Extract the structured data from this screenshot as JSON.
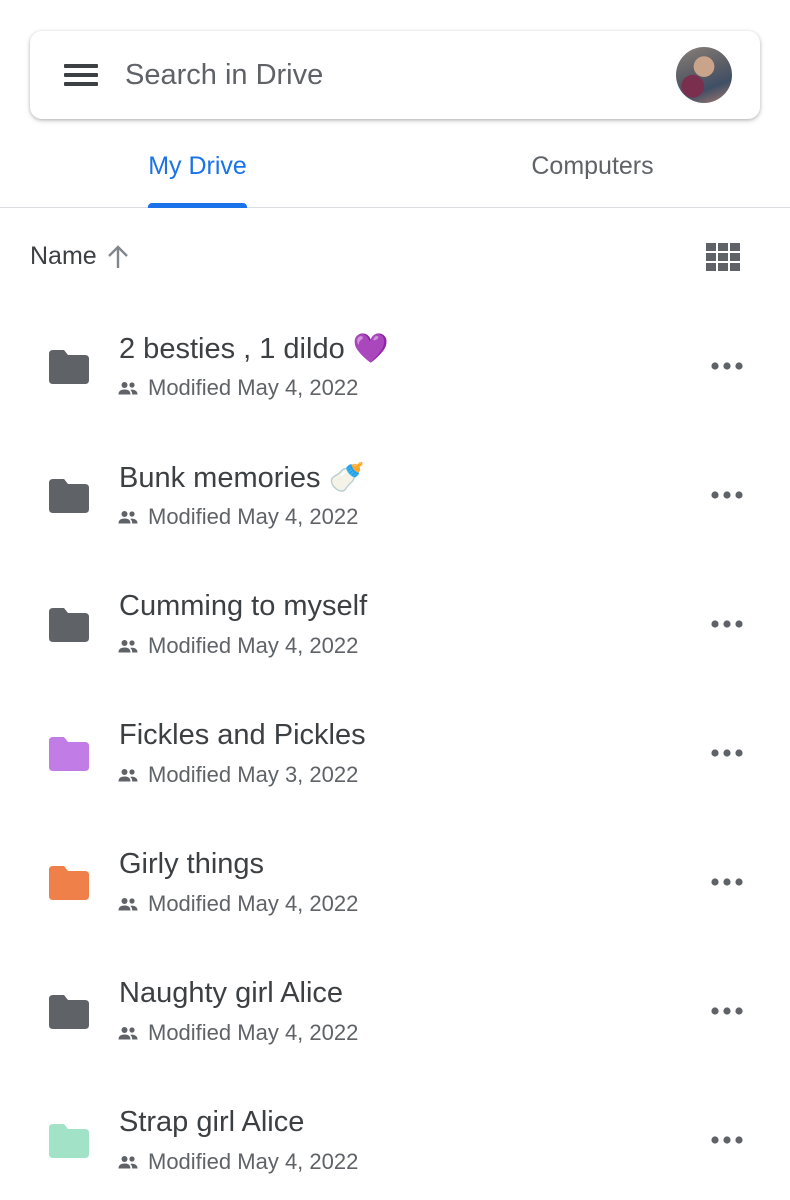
{
  "search": {
    "placeholder": "Search in Drive",
    "menu_icon": "hamburger-menu-icon",
    "avatar_icon": "profile-avatar"
  },
  "tabs": [
    {
      "label": "My Drive",
      "active": true
    },
    {
      "label": "Computers",
      "active": false
    }
  ],
  "sort": {
    "label": "Name",
    "direction_icon": "arrow-up-icon",
    "view_toggle_icon": "grid-view-icon"
  },
  "colors": {
    "accent": "#1a73e8",
    "text_primary": "#3c4043",
    "text_secondary": "#5f6368",
    "divider": "#dadce0"
  },
  "files": [
    {
      "name": "2 besties , 1 dildo 💜",
      "meta": "Modified May 4, 2022",
      "folder_color": "#5f6368",
      "shared": true
    },
    {
      "name": "Bunk memories 🍼",
      "meta": "Modified May 4, 2022",
      "folder_color": "#5f6368",
      "shared": true
    },
    {
      "name": "Cumming to myself",
      "meta": "Modified May 4, 2022",
      "folder_color": "#5f6368",
      "shared": true
    },
    {
      "name": "Fickles and Pickles",
      "meta": "Modified May 3, 2022",
      "folder_color": "#c27ce5",
      "shared": true
    },
    {
      "name": "Girly things",
      "meta": "Modified May 4, 2022",
      "folder_color": "#f0804a",
      "shared": true
    },
    {
      "name": "Naughty girl Alice",
      "meta": "Modified May 4, 2022",
      "folder_color": "#5f6368",
      "shared": true
    },
    {
      "name": "Strap girl Alice",
      "meta": "Modified May 4, 2022",
      "folder_color": "#a2e3c8",
      "shared": true
    }
  ]
}
